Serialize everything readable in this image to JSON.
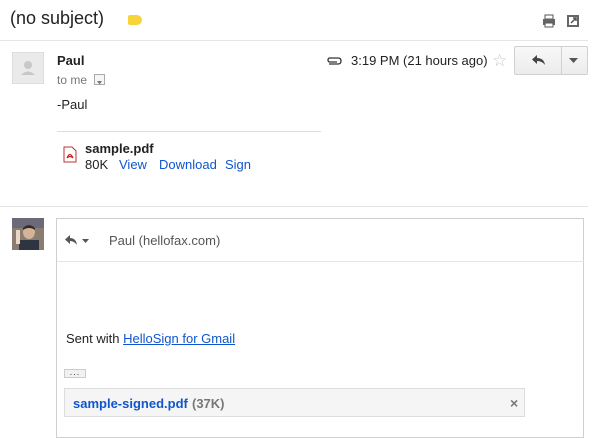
{
  "subject": "(no subject)",
  "colors": {
    "label": "#f7d43a",
    "link": "#1155cc"
  },
  "message": {
    "sender": "Paul",
    "to_line": "to me",
    "time": "3:19 PM (21 hours ago)",
    "body": "-Paul",
    "attachment": {
      "name": "sample.pdf",
      "size": "80K",
      "actions": [
        "View",
        "Download",
        "Sign"
      ]
    }
  },
  "reply": {
    "recipient": "Paul (hellofax.com)",
    "sent_with_prefix": "Sent with ",
    "sent_with_link": "HelloSign for Gmail",
    "trimmed_indicator": "...",
    "attachment": {
      "name": "sample-signed.pdf",
      "size": "(37K)"
    }
  },
  "icons": [
    "label-icon",
    "print-icon",
    "new-window-icon",
    "avatar-placeholder-icon",
    "paperclip-icon",
    "star-icon",
    "reply-icon",
    "more-chevron-icon",
    "pdf-icon",
    "close-icon"
  ]
}
